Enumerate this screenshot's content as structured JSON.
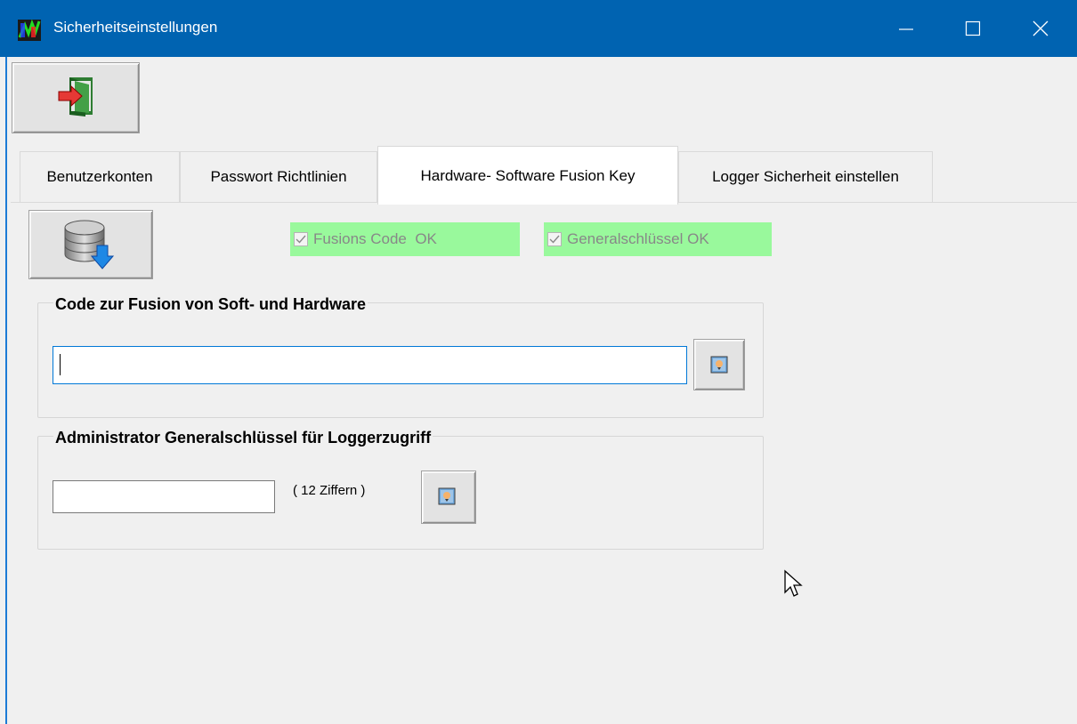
{
  "window": {
    "title": "Sicherheitseinstellungen",
    "minimize_icon": "minimize-icon",
    "maximize_icon": "maximize-icon",
    "close_icon": "close-icon",
    "titlebar_color": "#0063b1"
  },
  "toolbar": {
    "exit_icon": "exit-door-icon"
  },
  "tabs": [
    {
      "label": "Benutzerkonten",
      "active": false
    },
    {
      "label": "Passwort Richtlinien",
      "active": false
    },
    {
      "label": "Hardware- Software Fusion Key",
      "active": true
    },
    {
      "label": "Logger Sicherheit einstellen",
      "active": false
    }
  ],
  "status": {
    "fusion_code": {
      "label": "Fusions Code  OK",
      "checked": true
    },
    "master_key": {
      "label": "Generalschlüssel OK",
      "checked": true
    },
    "ok_color": "#99f99c"
  },
  "groups": {
    "fusion": {
      "title": "Code zur Fusion von Soft- und Hardware",
      "input_value": ""
    },
    "admin": {
      "title": "Administrator Generalschlüssel für Loggerzugriff",
      "input_value": "",
      "hint": "( 12 Ziffern )"
    }
  }
}
